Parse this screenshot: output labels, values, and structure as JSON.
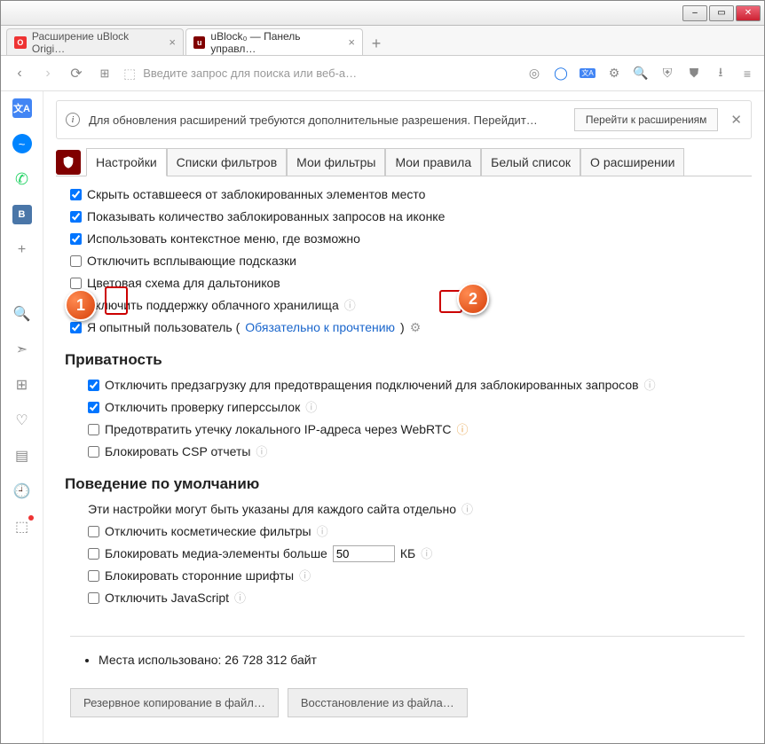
{
  "window": {
    "min": "–",
    "max": "▭",
    "close": "✕"
  },
  "tabs": {
    "t1": {
      "label": "Расширение uBlock Origi…"
    },
    "t2": {
      "label": "uBlock₀ — Панель управл…"
    },
    "plus": "+"
  },
  "addr": {
    "placeholder": "Введите запрос для поиска или веб-а…"
  },
  "notif": {
    "text": "Для обновления расширений требуются дополнительные разрешения. Перейдит…",
    "button": "Перейти к расширениям",
    "close": "✕"
  },
  "ub_tabs": {
    "t0": "Настройки",
    "t1": "Списки фильтров",
    "t2": "Мои фильтры",
    "t3": "Мои правила",
    "t4": "Белый список",
    "t5": "О расширении"
  },
  "settings": {
    "s0": "Скрыть оставшееся от заблокированных элементов место",
    "s1": "Показывать количество заблокированных запросов на иконке",
    "s2": "Использовать контекстное меню, где возможно",
    "s3": "Отключить всплывающие подсказки",
    "s4": "Цветовая схема для дальтоников",
    "s5": "Включить поддержку облачного хранилища",
    "s6_pre": "Я опытный пользователь (",
    "s6_link": "Обязательно к прочтению",
    "s6_post": ")"
  },
  "privacy": {
    "title": "Приватность",
    "p0": "Отключить предзагрузку для предотвращения подключений для заблокированных запросов",
    "p1": "Отключить проверку гиперссылок",
    "p2": "Предотвратить утечку локального IP-адреса через WebRTC",
    "p3": "Блокировать CSP отчеты"
  },
  "behavior": {
    "title": "Поведение по умолчанию",
    "sub": "Эти настройки могут быть указаны для каждого сайта отдельно",
    "b0": "Отключить косметические фильтры",
    "b1_pre": "Блокировать медиа-элементы больше",
    "b1_val": "50",
    "b1_post": "КБ",
    "b2": "Блокировать сторонние шрифты",
    "b3": "Отключить JavaScript"
  },
  "storage": {
    "text": "Места использовано: 26 728 312 байт"
  },
  "buttons": {
    "backup": "Резервное копирование в файл…",
    "restore": "Восстановление из файла…"
  },
  "callouts": {
    "c1": "1",
    "c2": "2"
  }
}
